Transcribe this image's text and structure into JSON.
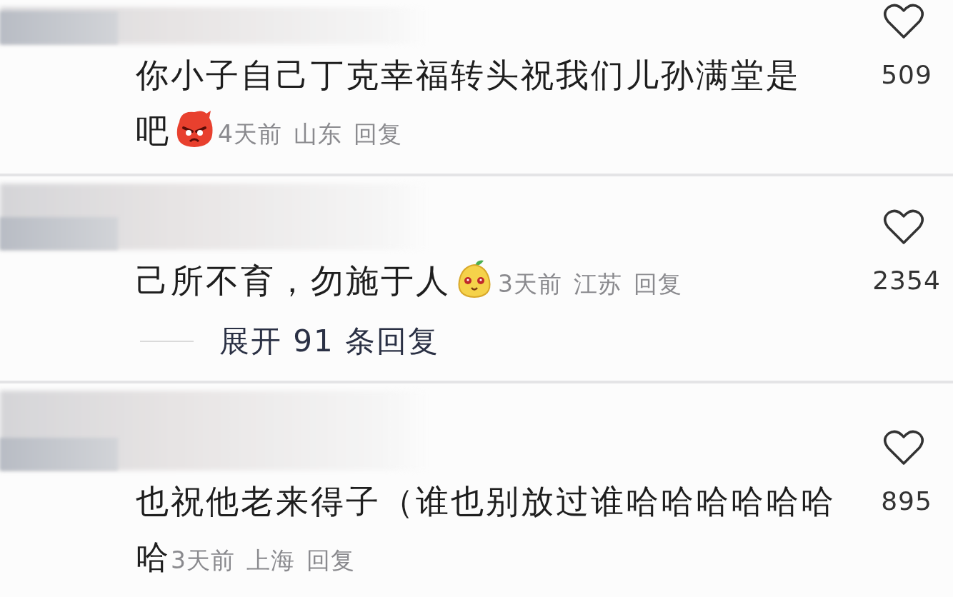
{
  "comments": [
    {
      "lines": [
        "你小子自己丁克幸福转头祝我们儿孙满堂是",
        "吧"
      ],
      "emoji": {
        "kind": "angry"
      },
      "time": "4天前",
      "location": "山东",
      "reply": "回复",
      "likes": "509"
    },
    {
      "lines": [
        "己所不育，勿施于人"
      ],
      "emoji": {
        "kind": "pear"
      },
      "time": "3天前",
      "location": "江苏",
      "reply": "回复",
      "likes": "2354",
      "expand_replies": "展开 91 条回复"
    },
    {
      "lines": [
        "也祝他老来得子（谁也别放过谁哈哈哈哈哈哈",
        "哈"
      ],
      "time": "3天前",
      "location": "上海",
      "reply": "回复",
      "likes": "895"
    }
  ]
}
